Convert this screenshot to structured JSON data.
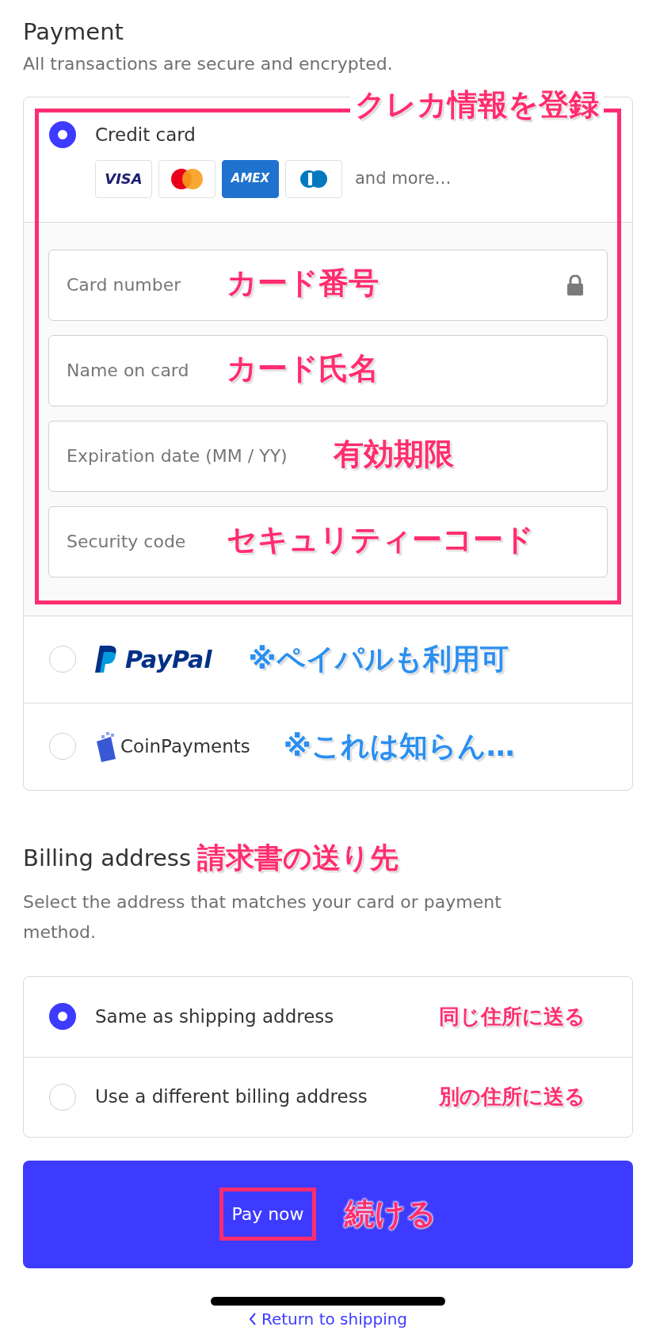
{
  "payment": {
    "title": "Payment",
    "subtitle": "All transactions are secure and encrypted."
  },
  "payment_methods": [
    {
      "kind": "card",
      "label": "Credit card",
      "selected": true,
      "brands": [
        {
          "kind": "visa",
          "text": "VISA"
        },
        {
          "kind": "mastercard"
        },
        {
          "kind": "amex",
          "text": "AMEX"
        },
        {
          "kind": "diners"
        }
      ],
      "more": "and more…",
      "frame_note": {
        "text": "クレカ情報を登録",
        "color": "#ff2d6f"
      },
      "fields": [
        {
          "placeholder": "Card number",
          "lock": true,
          "note": {
            "text": "カード番号",
            "color": "#ff2d6f"
          }
        },
        {
          "placeholder": "Name on card",
          "note": {
            "text": "カード氏名",
            "color": "#ff2d6f"
          }
        },
        {
          "placeholder": "Expiration date (MM / YY)",
          "note": {
            "text": "有効期限",
            "color": "#ff2d6f"
          }
        },
        {
          "placeholder": "Security code",
          "note": {
            "text": "セキュリティーコード",
            "color": "#ff2d6f"
          }
        }
      ]
    },
    {
      "kind": "paypal",
      "logo_text": "PayPal",
      "selected": false,
      "note": {
        "text": "※ペイパルも利用可",
        "color": "#2b8ff0"
      }
    },
    {
      "kind": "coinpayments",
      "logo_text": "CoinPayments",
      "selected": false,
      "note": {
        "text": "※これは知らん…",
        "color": "#2b8ff0"
      }
    }
  ],
  "billing": {
    "title": "Billing address",
    "title_note": {
      "text": "請求書の送り先",
      "color": "#ff2d6f"
    },
    "subtitle": "Select the address that matches your card or payment method.",
    "options": [
      {
        "label": "Same as shipping address",
        "selected": true,
        "note": {
          "text": "同じ住所に送る",
          "color": "#ff2d6f"
        }
      },
      {
        "label": "Use a different billing address",
        "selected": false,
        "note": {
          "text": "別の住所に送る",
          "color": "#ff2d6f"
        }
      }
    ]
  },
  "pay_button": {
    "label": "Pay now",
    "note": {
      "text": "続ける",
      "color": "#ff2d6f"
    }
  },
  "return_link": "Return to shipping"
}
